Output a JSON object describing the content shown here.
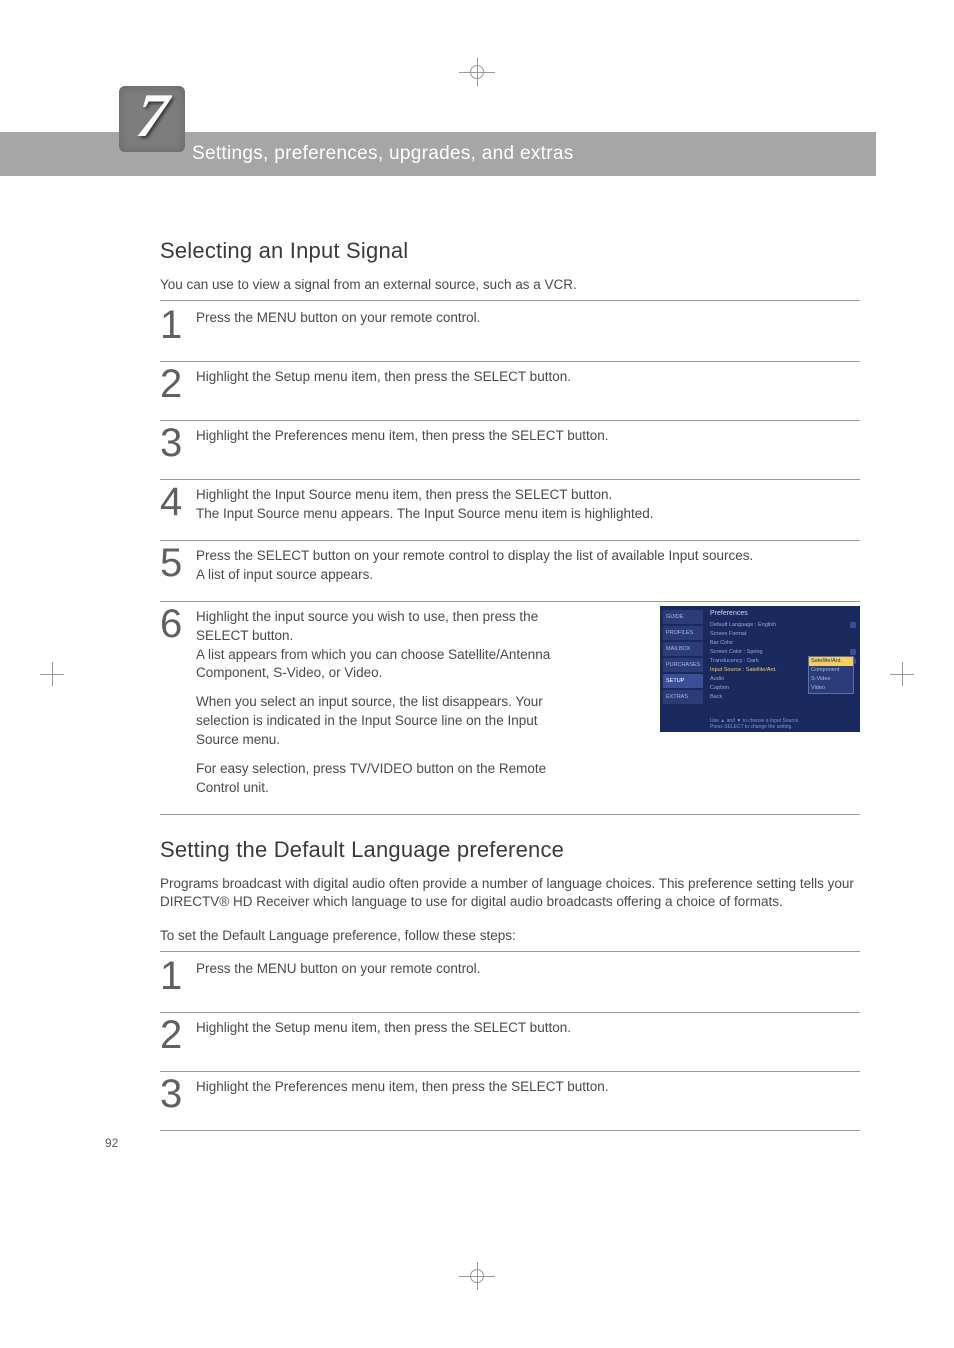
{
  "chapter": {
    "number": "7",
    "title": "Settings, preferences, upgrades, and extras"
  },
  "section1": {
    "heading": "Selecting an Input Signal",
    "intro": "You can use to view a signal from an external source, such as a VCR.",
    "steps": [
      {
        "n": "1",
        "text": "Press the MENU button on your remote control."
      },
      {
        "n": "2",
        "text": "Highlight the Setup menu item, then press the SELECT button."
      },
      {
        "n": "3",
        "text": "Highlight the Preferences menu item, then press the SELECT button."
      },
      {
        "n": "4",
        "text": "Highlight the Input Source menu item, then press the SELECT button.\nThe Input Source menu appears. The Input Source menu item is highlighted."
      },
      {
        "n": "5",
        "text": "Press the SELECT button on your remote control to display the list of available Input sources.\nA list of input source appears."
      },
      {
        "n": "6",
        "text_a": "Highlight the input source you wish to use, then press the SELECT button.\nA list appears from which you can choose Satellite/Antenna Component, S-Video, or Video.",
        "text_b": "When you select an input source, the list disappears. Your selection is indicated in the Input Source line on the Input Source menu.",
        "text_c": "For easy selection, press TV/VIDEO button on the Remote Control unit."
      }
    ]
  },
  "section2": {
    "heading": "Setting the Default Language preference",
    "intro1": "Programs broadcast with digital audio often provide a number of language choices. This preference setting tells your DIRECTV® HD Receiver which language to use for digital audio broadcasts offering a choice of formats.",
    "intro2": "To set the Default Language preference, follow these steps:",
    "steps": [
      {
        "n": "1",
        "text": "Press the MENU button on your remote control."
      },
      {
        "n": "2",
        "text": "Highlight the Setup menu item, then press the SELECT button."
      },
      {
        "n": "3",
        "text": "Highlight the Preferences menu item, then press the SELECT button."
      }
    ]
  },
  "screenshot": {
    "tabs": [
      "GUIDE",
      "PROFILES",
      "MAILBOX",
      "PURCHASES",
      "SETUP",
      "EXTRAS"
    ],
    "title": "Preferences",
    "lines": [
      {
        "label": "Default Language : English",
        "lock": true
      },
      {
        "label": "Screen Format"
      },
      {
        "label": "Bar Color"
      },
      {
        "label": "Screen Color : Spring",
        "lock": true
      },
      {
        "label": "Translucency : Dark",
        "lock": true
      },
      {
        "label": "Input Source : Satellite/Ant.",
        "hl": true
      },
      {
        "label": "Audio"
      },
      {
        "label": "Caption"
      },
      {
        "label": "Back"
      }
    ],
    "popup": [
      "Satellite/Ant.",
      "Component",
      "S-Video",
      "Video"
    ],
    "hint": "Use ▲ and ▼ to choose a Input Source.\nPress SELECT to change the setting."
  },
  "page_number": "92"
}
